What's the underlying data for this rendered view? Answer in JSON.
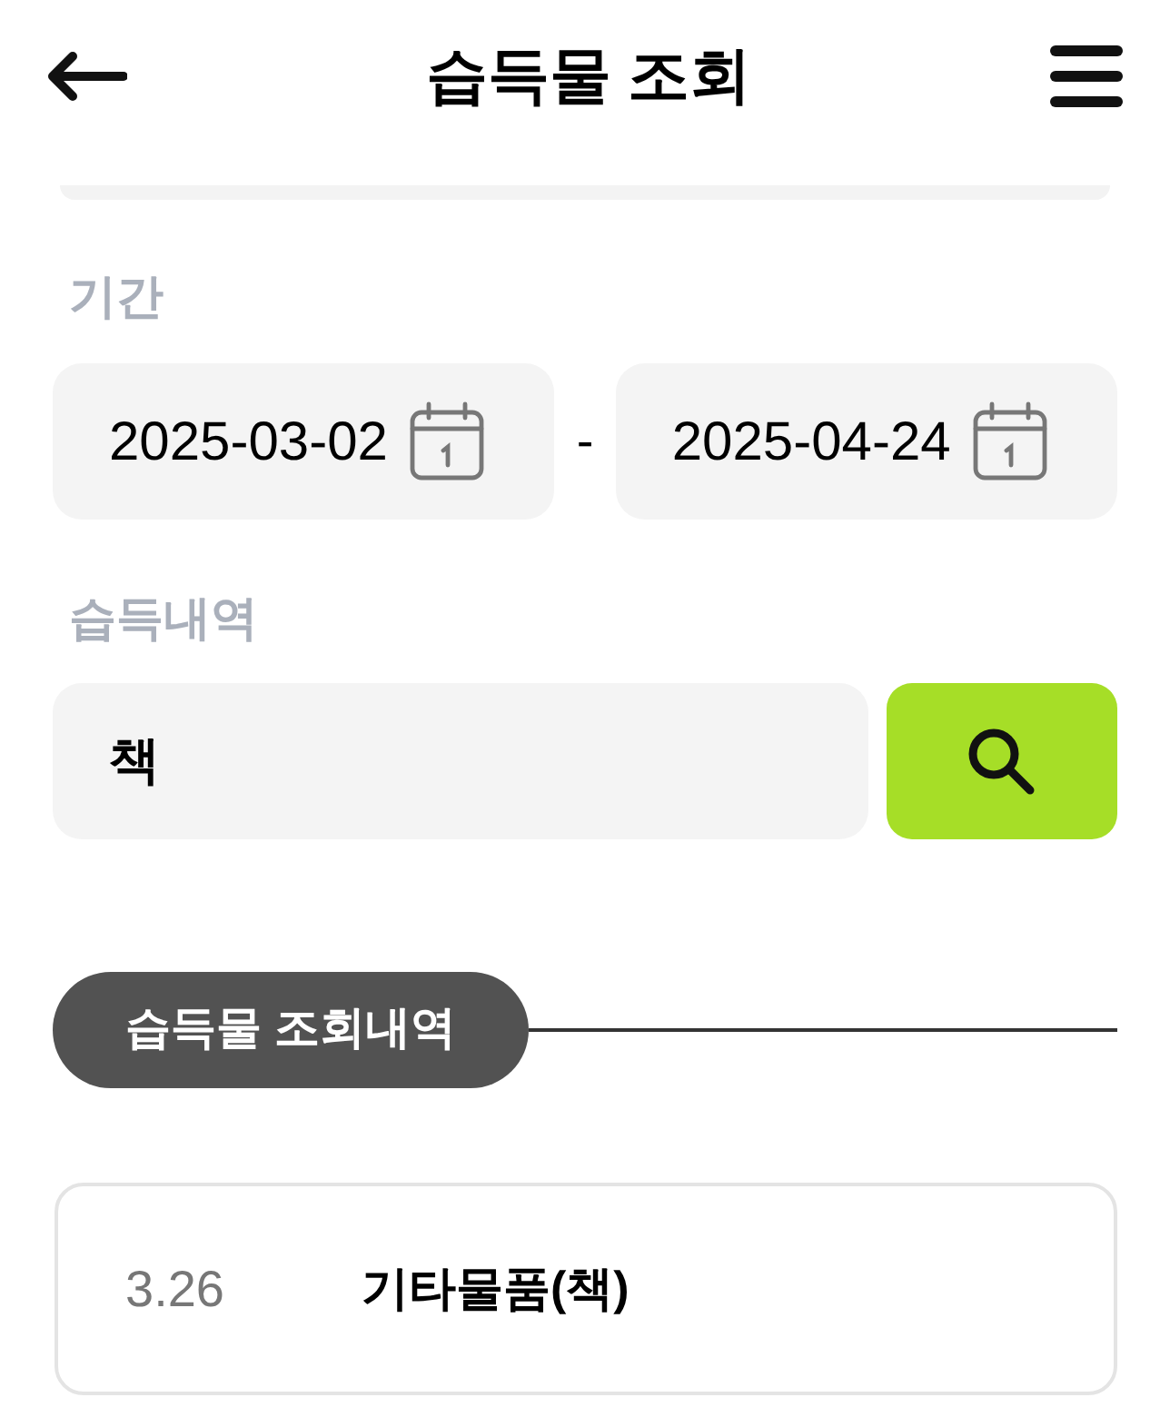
{
  "header": {
    "title": "습득물 조회"
  },
  "period": {
    "label": "기간",
    "start": "2025-03-02",
    "separator": "-",
    "end": "2025-04-24"
  },
  "search": {
    "label": "습득내역",
    "value": "책"
  },
  "results": {
    "heading": "습득물 조회내역",
    "items": [
      {
        "date": "3.26",
        "name": "기타물품(책)"
      }
    ]
  }
}
